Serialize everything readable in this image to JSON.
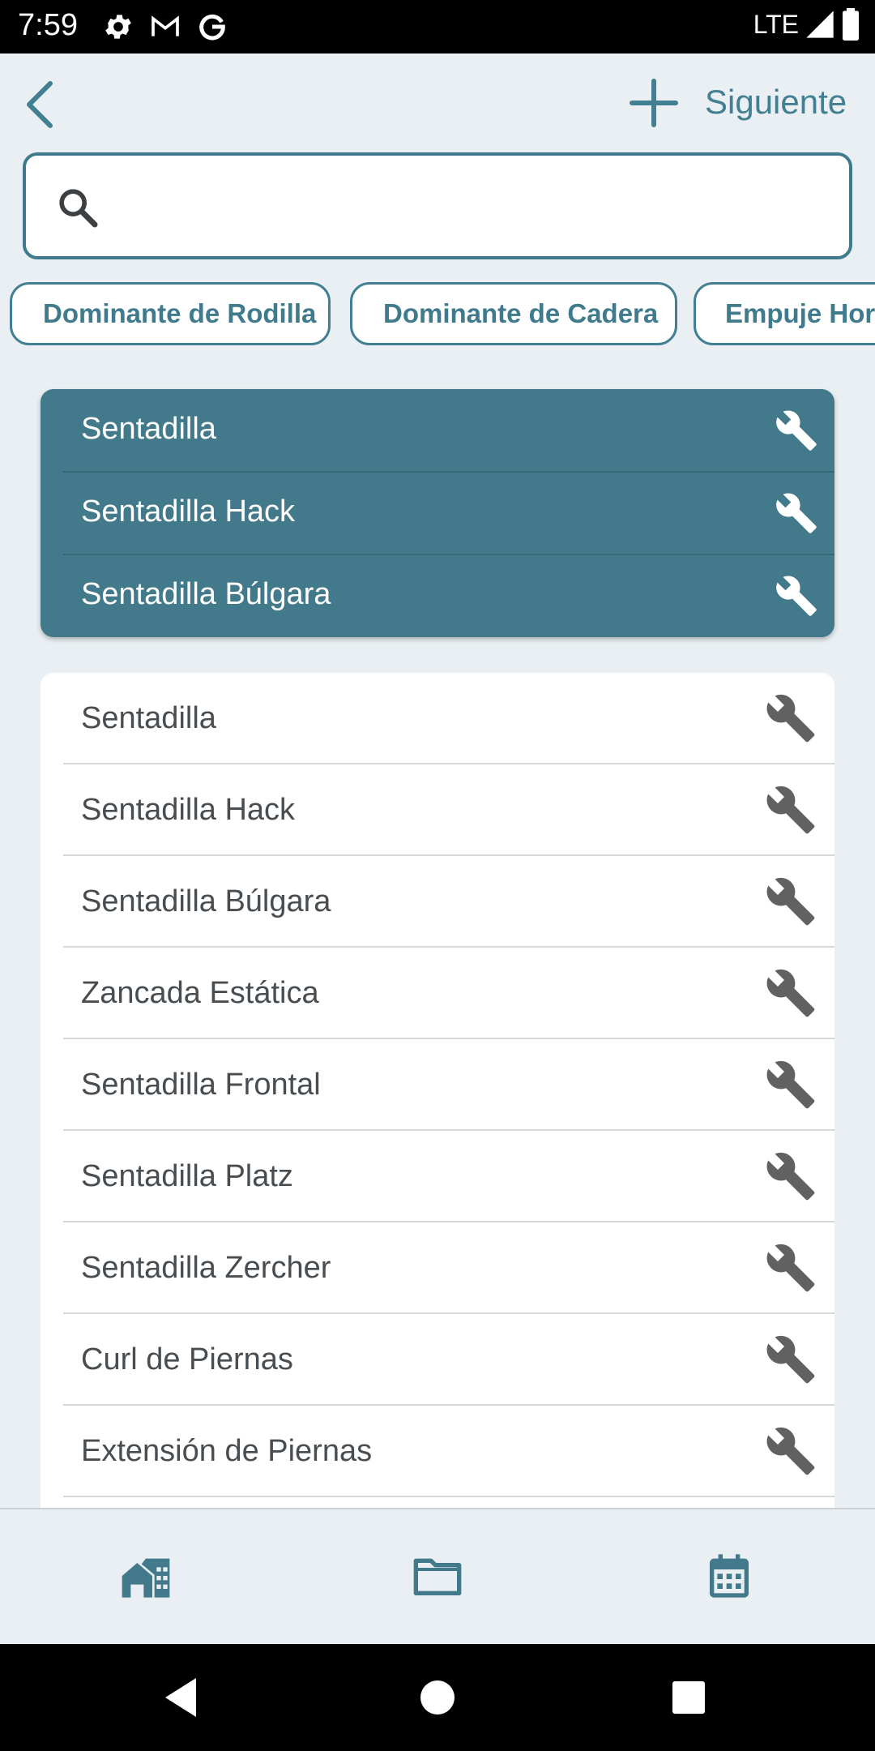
{
  "status_bar": {
    "time": "7:59",
    "network": "LTE",
    "icons": [
      "gear-icon",
      "gmail-icon",
      "google-icon",
      "signal-icon",
      "battery-icon"
    ]
  },
  "header": {
    "back_icon": "chevron-left-icon",
    "add_icon": "plus-icon",
    "next_label": "Siguiente"
  },
  "search": {
    "value": "",
    "icon": "search-icon"
  },
  "filters": [
    {
      "label": "Dominante de Rodilla"
    },
    {
      "label": "Dominante de Cadera"
    },
    {
      "label": "Empuje Horizontal"
    }
  ],
  "selected_exercises": [
    {
      "name": "Sentadilla"
    },
    {
      "name": "Sentadilla Hack"
    },
    {
      "name": "Sentadilla Búlgara"
    }
  ],
  "exercises": [
    {
      "name": "Sentadilla"
    },
    {
      "name": "Sentadilla Hack"
    },
    {
      "name": "Sentadilla Búlgara"
    },
    {
      "name": "Zancada Estática"
    },
    {
      "name": "Sentadilla Frontal"
    },
    {
      "name": "Sentadilla Platz"
    },
    {
      "name": "Sentadilla Zercher"
    },
    {
      "name": "Curl de Piernas"
    },
    {
      "name": "Extensión de Piernas"
    }
  ],
  "bottom_nav": [
    {
      "icon": "home-icon"
    },
    {
      "icon": "folder-icon"
    },
    {
      "icon": "calendar-icon"
    }
  ],
  "colors": {
    "accent": "#437a8b",
    "background": "#e9eff2",
    "text": "#474d51",
    "icon_gray": "#616161"
  }
}
